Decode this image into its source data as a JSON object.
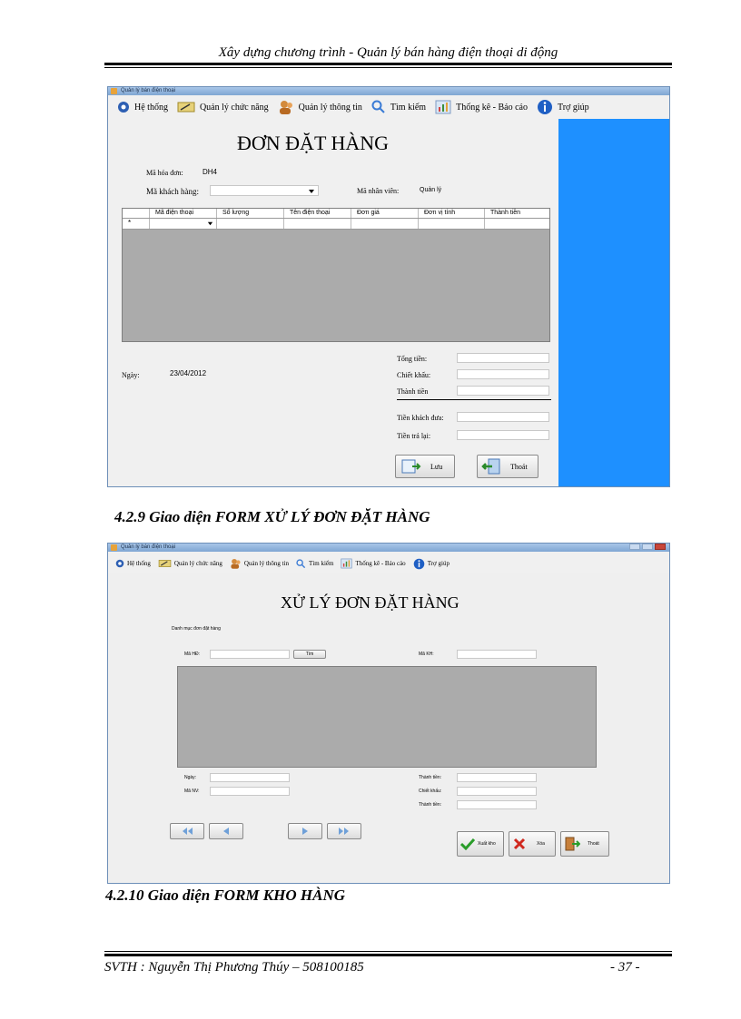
{
  "header": {
    "title": "Xây dựng chương trình - Quản lý bán hàng điện thoại di động"
  },
  "footer": {
    "author": "SVTH : Nguyễn Thị Phương Thúy – 508100185",
    "page": "- 37 -"
  },
  "figure1": {
    "window_title": "Quản lý bán điện thoại",
    "menu": [
      "Hệ thống",
      "Quản lý chức năng",
      "Quản lý thông tin",
      "Tìm kiếm",
      "Thống kê - Báo cáo",
      "Trợ giúp"
    ],
    "form_title": "ĐƠN ĐẶT HÀNG",
    "ma_hoa_don_label": "Mã hóa đơn:",
    "ma_hoa_don_value": "DH4",
    "ma_khach_hang_label": "Mã khách hàng:",
    "ma_nhan_vien_label": "Mã nhân viên:",
    "ma_nhan_vien_value": "Quản lý",
    "grid_columns": [
      "Mã điện thoại",
      "Số lượng",
      "Tên điện thoại",
      "Đơn giá",
      "Đơn vị tính",
      "Thành tiền"
    ],
    "row_marker": "*",
    "tong_tien_label": "Tổng tiền:",
    "chiet_khau_label": "Chiết khấu:",
    "thanh_tien_label": "Thành tiền",
    "ngay_label": "Ngày:",
    "ngay_value": "23/04/2012",
    "tien_khach_dua_label": "Tiền khách đưa:",
    "tien_tra_lai_label": "Tiền trả lại:",
    "luu_button": "Lưu",
    "thoat_button": "Thoát"
  },
  "caption1": "4.2.9 Giao diện FORM XỬ LÝ ĐƠN ĐẶT HÀNG",
  "figure2": {
    "window_title": "Quản lý bán điện thoại",
    "menu": [
      "Hệ thống",
      "Quản lý chức năng",
      "Quản lý thông tin",
      "Tìm kiếm",
      "Thống kê - Báo cáo",
      "Trợ giúp"
    ],
    "form_title": "XỬ LÝ ĐƠN ĐẶT HÀNG",
    "danh_muc_label": "Danh mục đơn đặt hàng",
    "ma_hd_label": "Mã HĐ:",
    "tim_button": "Tìm",
    "ma_kh_label": "Mã KH:",
    "ngay_label": "Ngày:",
    "ma_nv_label": "Mã NV:",
    "tam_tinh_label": "Thành tiền:",
    "chiet_khau_label": "Chiết khấu:",
    "thanh_tien_label": "Thành tiền:",
    "xuat_kho_button": "Xuất kho",
    "xoa_button": "Xóa",
    "thoat_button": "Thoát"
  },
  "caption2": "4.2.10 Giao diện FORM KHO HÀNG",
  "colors": {
    "panel_blue": "#1e90ff",
    "grid_gray": "#ababab",
    "titlebar": "#7fa6d3"
  }
}
